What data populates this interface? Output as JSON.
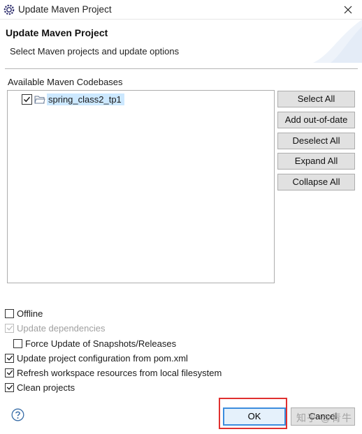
{
  "window": {
    "title": "Update Maven Project",
    "app_icon": "eclipse-gear-icon",
    "close_icon": "close-icon"
  },
  "header": {
    "title": "Update Maven Project",
    "message": "Select Maven projects and update options"
  },
  "codebases": {
    "label": "Available Maven Codebases",
    "items": [
      {
        "name": "spring_class2_tp1",
        "checked": true,
        "icon": "project-folder-icon"
      }
    ]
  },
  "buttons": {
    "select_all": "Select All",
    "add_out_of_date": "Add out-of-date",
    "deselect_all": "Deselect All",
    "expand_all": "Expand All",
    "collapse_all": "Collapse All"
  },
  "options": {
    "offline": {
      "label": "Offline",
      "checked": false
    },
    "update_dependencies": {
      "label": "Update dependencies",
      "checked": true,
      "enabled": false
    },
    "force_update": {
      "label": "Force Update of Snapshots/Releases",
      "checked": false
    },
    "update_config": {
      "label": "Update project configuration from pom.xml",
      "checked": true
    },
    "refresh_workspace": {
      "label": "Refresh workspace resources from local filesystem",
      "checked": true
    },
    "clean_projects": {
      "label": "Clean projects",
      "checked": true
    }
  },
  "footer": {
    "help_icon": "help-icon",
    "ok_label": "OK",
    "cancel_label": "Cancel",
    "watermark": "知乎 @青牛"
  },
  "colors": {
    "selection": "#cce8ff",
    "highlight": "#e0302f",
    "default_button_border": "#3c8dde"
  }
}
